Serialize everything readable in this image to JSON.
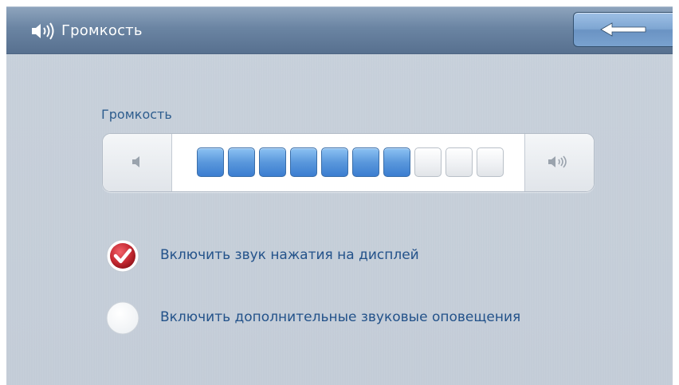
{
  "header": {
    "title": "Громкость",
    "back_icon": "arrow-left-icon",
    "title_icon": "speaker-icon"
  },
  "volume": {
    "label": "Громкость",
    "level": 7,
    "max": 10,
    "decrease_icon": "speaker-low-icon",
    "increase_icon": "speaker-high-icon"
  },
  "options": [
    {
      "label": "Включить звук нажатия на дисплей",
      "checked": true
    },
    {
      "label": "Включить дополнительные звуковые оповещения",
      "checked": false
    }
  ],
  "colors": {
    "header": "#6b85a3",
    "segment_on": "#4a8bd6",
    "check_red": "#c1282f",
    "label_text": "#23528a"
  }
}
